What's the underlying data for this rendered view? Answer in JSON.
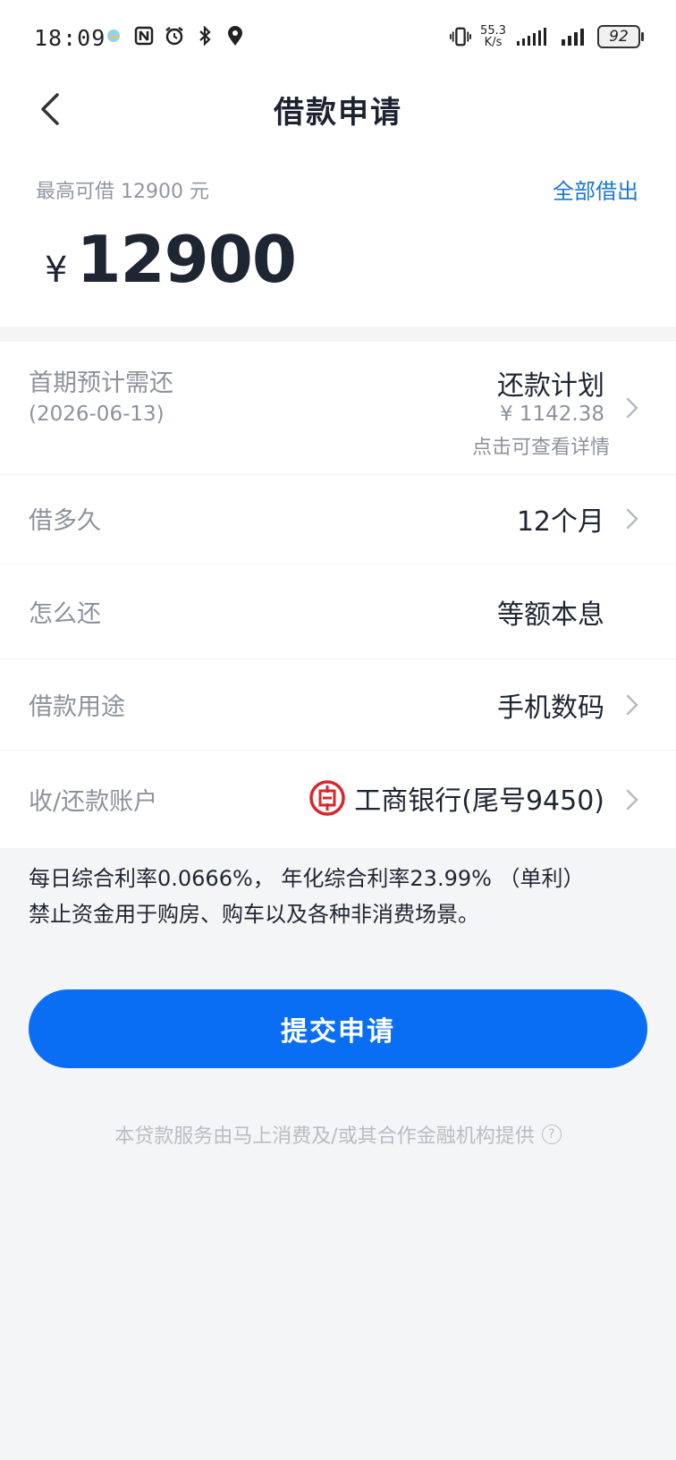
{
  "status_bar": {
    "time": "18:09",
    "net_speed_value": "55.3",
    "net_speed_unit": "K/s",
    "battery": "92"
  },
  "header": {
    "title": "借款申请"
  },
  "loan": {
    "max_label": "最高可借  12900  元",
    "borrow_all": "全部借出",
    "currency": "¥",
    "amount": "12900"
  },
  "rows": {
    "first_payment": {
      "label": "首期预计需还",
      "date": "(2026-06-13)",
      "plan_title": "还款计划",
      "plan_amount": "¥ 1142.38",
      "plan_hint": "点击可查看详情"
    },
    "term": {
      "label": "借多久",
      "value": "12个月"
    },
    "repay_method": {
      "label": "怎么还",
      "value": "等额本息"
    },
    "purpose": {
      "label": "借款用途",
      "value": "手机数码"
    },
    "account": {
      "label": "收/还款账户",
      "value": "工商银行(尾号9450)"
    }
  },
  "notes": {
    "line1": "每日综合利率0.0666%， 年化综合利率23.99% （单利）",
    "line2": "禁止资金用于购房、购车以及各种非消费场景。"
  },
  "submit_label": "提交申请",
  "disclaimer": "本贷款服务由马上消费及/或其合作金融机构提供",
  "colors": {
    "accent": "#0a6ef5",
    "link": "#1677d9",
    "bank_red": "#d8262a"
  }
}
